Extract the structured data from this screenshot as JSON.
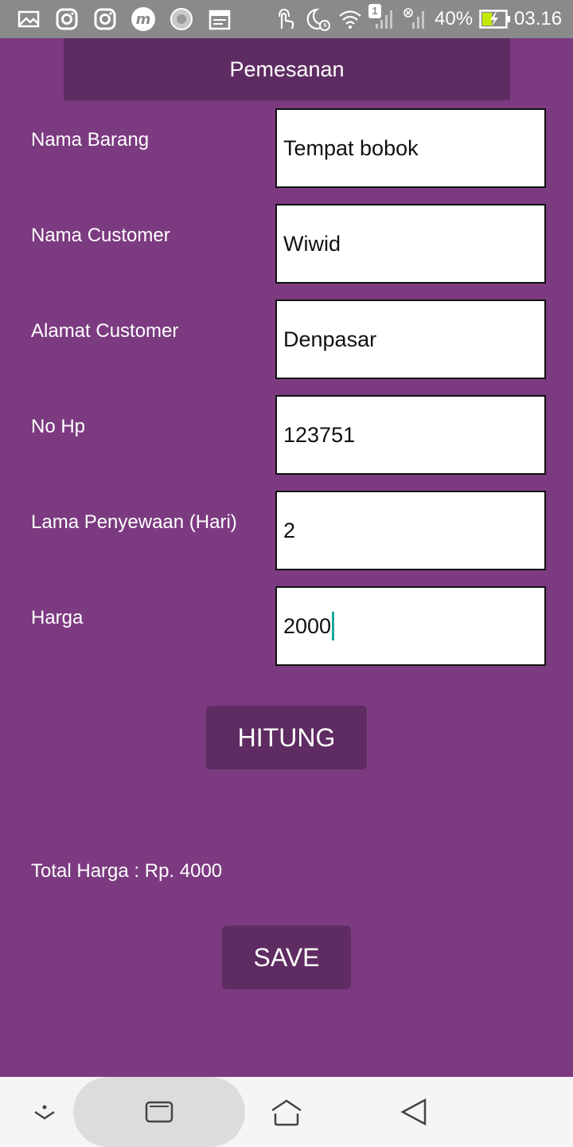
{
  "status_bar": {
    "battery": "40%",
    "time": "03.16",
    "badge": "1",
    "icons": [
      "gallery-icon",
      "instagram-icon",
      "instagram-icon",
      "m-app-icon",
      "loading-icon",
      "calendar-icon",
      "touch-icon",
      "sleep-alarm-icon",
      "wifi-icon",
      "signal-icon",
      "signal-off-icon",
      "battery-icon"
    ]
  },
  "header": {
    "title": "Pemesanan"
  },
  "form": {
    "nama_barang": {
      "label": "Nama Barang",
      "value": "Tempat bobok"
    },
    "nama_customer": {
      "label": "Nama Customer",
      "value": "Wiwid"
    },
    "alamat_customer": {
      "label": "Alamat Customer",
      "value": "Denpasar"
    },
    "no_hp": {
      "label": "No Hp",
      "value": "123751"
    },
    "lama_penyewaan": {
      "label": "Lama Penyewaan (Hari)",
      "value": "2"
    },
    "harga": {
      "label": "Harga",
      "value": "2000"
    }
  },
  "actions": {
    "hitung_label": "HITUNG",
    "save_label": "SAVE"
  },
  "result": {
    "total_text": "Total Harga : Rp. 4000"
  },
  "nav_bar": {
    "icons": [
      "expand-down-icon",
      "recents-icon",
      "home-icon",
      "back-icon"
    ]
  },
  "colors": {
    "background": "#7c3b80",
    "accent": "#5e2c62",
    "status_bar": "#8a8a8a",
    "cursor": "#1aa89a"
  }
}
